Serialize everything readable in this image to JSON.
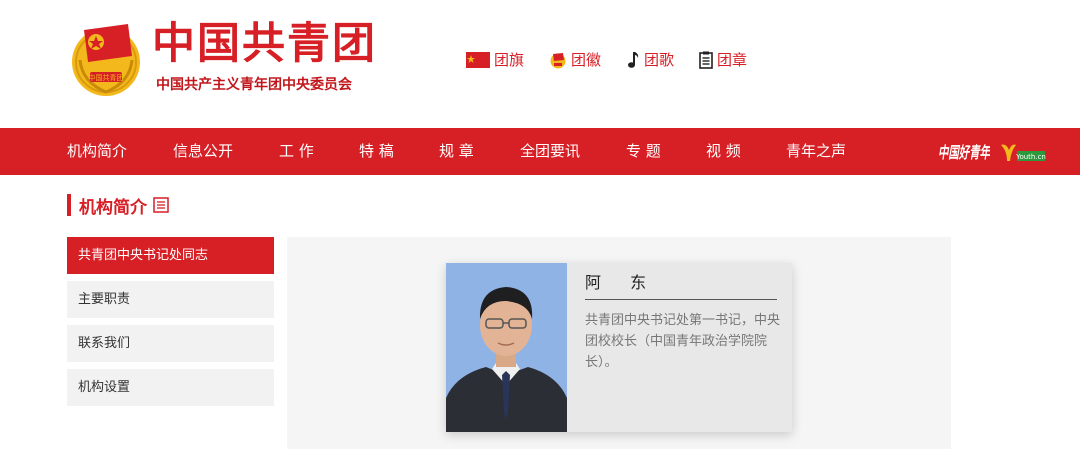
{
  "header": {
    "title": "中国共青团",
    "subtitle": "中国共产主义青年团中央委员会",
    "emblem_text": "中国共青团"
  },
  "symbols": [
    {
      "label": "团旗",
      "icon": "flag-icon"
    },
    {
      "label": "团徽",
      "icon": "emblem-icon"
    },
    {
      "label": "团歌",
      "icon": "music-note-icon"
    },
    {
      "label": "团章",
      "icon": "document-icon"
    }
  ],
  "nav": {
    "items": [
      "机构简介",
      "信息公开",
      "工  作",
      "特  稿",
      "规  章",
      "全团要讯",
      "专  题",
      "视  频",
      "青年之声"
    ],
    "logo1_text": "中国好青年",
    "logo2_text": "Youth.cn"
  },
  "section": {
    "title": "机构简介"
  },
  "side_menu": {
    "items": [
      "共青团中央书记处同志",
      "主要职责",
      "联系我们",
      "机构设置"
    ],
    "active_index": 0
  },
  "profile": {
    "name": "阿  东",
    "description": "共青团中央书记处第一书记，中央团校校长（中国青年政治学院院长）。"
  },
  "colors": {
    "brand_red": "#d71f26",
    "gold": "#f2b81c",
    "panel_bg": "#f5f5f5",
    "card_bg": "#e8e8e8"
  }
}
